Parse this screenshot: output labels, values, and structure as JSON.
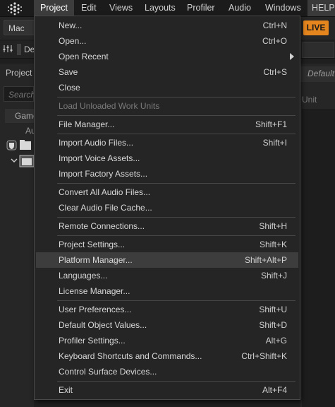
{
  "menubar": {
    "items": [
      "Project",
      "Edit",
      "Views",
      "Layouts",
      "Profiler",
      "Audio",
      "Windows"
    ],
    "help_label": "HELP",
    "active": "Project"
  },
  "toolbar": {
    "platform": "Mac",
    "live_label": "LIVE",
    "def_label": "Def",
    "right_default": "Default"
  },
  "left_panel": {
    "title": "Project",
    "search_placeholder": "Search",
    "tab_label": "Game",
    "column_label": "Au"
  },
  "right_panel": {
    "unit_label": "Unit"
  },
  "menu": {
    "items": [
      {
        "label": "New...",
        "shortcut": "Ctrl+N"
      },
      {
        "label": "Open...",
        "shortcut": "Ctrl+O"
      },
      {
        "label": "Open Recent",
        "shortcut": ""
      },
      {
        "label": "Save",
        "shortcut": "Ctrl+S"
      },
      {
        "label": "Close",
        "shortcut": ""
      },
      {
        "label": "Load Unloaded Work Units",
        "shortcut": ""
      },
      {
        "label": "File Manager...",
        "shortcut": "Shift+F1"
      },
      {
        "label": "Import Audio Files...",
        "shortcut": "Shift+I"
      },
      {
        "label": "Import Voice Assets...",
        "shortcut": ""
      },
      {
        "label": "Import Factory Assets...",
        "shortcut": ""
      },
      {
        "label": "Convert All Audio Files...",
        "shortcut": ""
      },
      {
        "label": "Clear Audio File Cache...",
        "shortcut": ""
      },
      {
        "label": "Remote Connections...",
        "shortcut": "Shift+H"
      },
      {
        "label": "Project Settings...",
        "shortcut": "Shift+K"
      },
      {
        "label": "Platform Manager...",
        "shortcut": "Shift+Alt+P"
      },
      {
        "label": "Languages...",
        "shortcut": "Shift+J"
      },
      {
        "label": "License Manager...",
        "shortcut": ""
      },
      {
        "label": "User Preferences...",
        "shortcut": "Shift+U"
      },
      {
        "label": "Default Object Values...",
        "shortcut": "Shift+D"
      },
      {
        "label": "Profiler Settings...",
        "shortcut": "Alt+G"
      },
      {
        "label": "Keyboard Shortcuts and Commands...",
        "shortcut": "Ctrl+Shift+K"
      },
      {
        "label": "Control Surface Devices...",
        "shortcut": ""
      },
      {
        "label": "Exit",
        "shortcut": "Alt+F4"
      }
    ]
  },
  "colors": {
    "background": "#1f1f1f",
    "menu_bg": "#252525",
    "hover": "#3d3d3d",
    "live": "#e5851e"
  }
}
